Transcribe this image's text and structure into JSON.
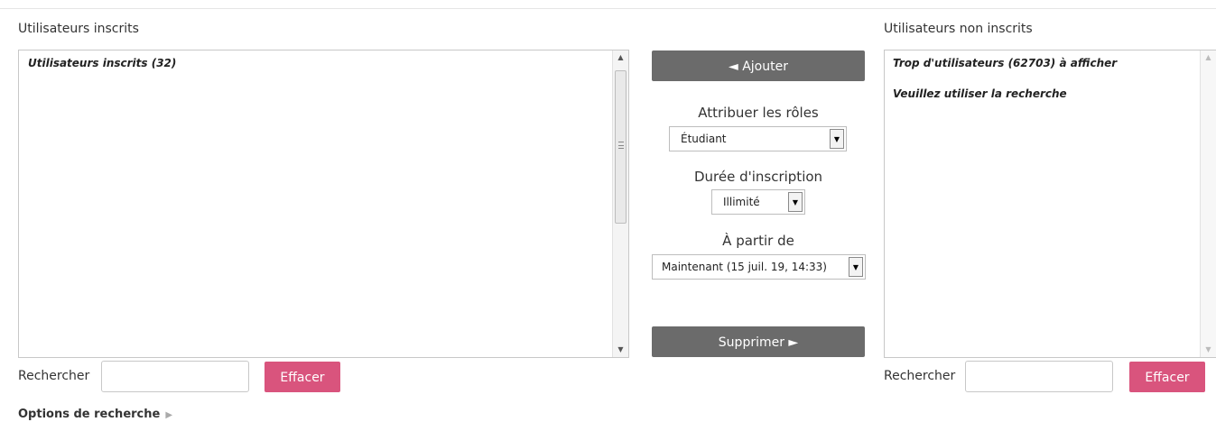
{
  "left": {
    "title": "Utilisateurs inscrits",
    "listbox_items": [
      "Utilisateurs inscrits (32)"
    ],
    "search_label": "Rechercher",
    "search_value": "",
    "clear_label": "Effacer"
  },
  "right": {
    "title": "Utilisateurs non inscrits",
    "listbox_items": [
      "Trop d'utilisateurs (62703) à afficher",
      "Veuillez utiliser la recherche"
    ],
    "search_label": "Rechercher",
    "search_value": "",
    "clear_label": "Effacer"
  },
  "center": {
    "add_label": "◄ Ajouter",
    "roles_label": "Attribuer les rôles",
    "roles_value": "Étudiant",
    "duration_label": "Durée d'inscription",
    "duration_value": "Illimité",
    "start_label": "À partir de",
    "start_value": "Maintenant (15 juil. 19, 14:33)",
    "remove_label": "Supprimer ►"
  },
  "search_options_label": "Options de recherche",
  "colors": {
    "gray_button": "#6b6b6b",
    "pink_button": "#d9547d"
  }
}
